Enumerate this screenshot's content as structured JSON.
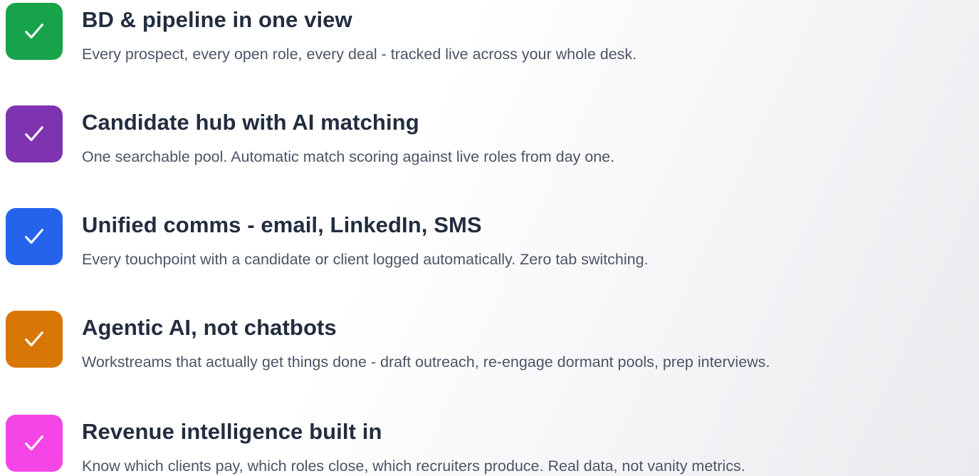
{
  "features": [
    {
      "title": "BD & pipeline in one view",
      "description": "Every prospect, every open role, every deal - tracked live across your whole desk.",
      "icon": "check-icon",
      "color": "#16a34a"
    },
    {
      "title": "Candidate hub with AI matching",
      "description": "One searchable pool. Automatic match scoring against live roles from day one.",
      "icon": "check-icon",
      "color": "#7e34b0"
    },
    {
      "title": "Unified comms - email, LinkedIn, SMS",
      "description": "Every touchpoint with a candidate or client logged automatically. Zero tab switching.",
      "icon": "check-icon",
      "color": "#2563eb"
    },
    {
      "title": "Agentic AI, not chatbots",
      "description": "Workstreams that actually get things done - draft outreach, re-engage dormant pools, prep interviews.",
      "icon": "check-icon",
      "color": "#d97706"
    },
    {
      "title": "Revenue intelligence built in",
      "description": "Know which clients pay, which roles close, which recruiters produce. Real data, not vanity metrics.",
      "icon": "check-icon",
      "color": "#f545e6"
    }
  ]
}
